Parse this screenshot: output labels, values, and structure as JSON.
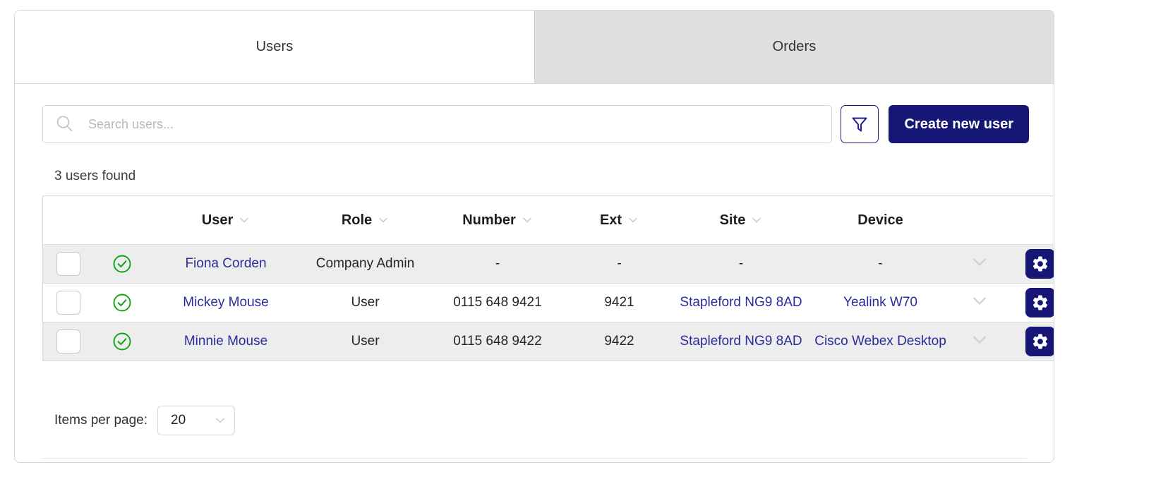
{
  "tabs": [
    {
      "label": "Users",
      "active": true,
      "name": "tab-users"
    },
    {
      "label": "Orders",
      "active": false,
      "name": "tab-orders"
    }
  ],
  "toolbar": {
    "search_placeholder": "Search users...",
    "search_value": "",
    "search_icon": "search-icon",
    "filter_icon": "filter-funnel-icon",
    "create_label": "Create new user"
  },
  "results": {
    "count_text": "3 users found"
  },
  "table": {
    "columns": [
      {
        "label": "",
        "sortable": false,
        "key": "select"
      },
      {
        "label": "",
        "sortable": false,
        "key": "status"
      },
      {
        "label": "User",
        "sortable": true,
        "key": "user"
      },
      {
        "label": "Role",
        "sortable": true,
        "key": "role"
      },
      {
        "label": "Number",
        "sortable": true,
        "key": "number"
      },
      {
        "label": "Ext",
        "sortable": true,
        "key": "ext"
      },
      {
        "label": "Site",
        "sortable": true,
        "key": "site"
      },
      {
        "label": "Device",
        "sortable": false,
        "key": "device"
      },
      {
        "label": "",
        "sortable": false,
        "key": "expand"
      },
      {
        "label": "",
        "sortable": false,
        "key": "actions"
      }
    ],
    "rows": [
      {
        "status_icon": "check-circle-icon",
        "user": "Fiona Corden",
        "role": "Company Admin",
        "number": "-",
        "ext": "-",
        "site": "-",
        "device": "-",
        "user_is_link": true,
        "site_is_link": false,
        "device_is_link": false
      },
      {
        "status_icon": "check-circle-icon",
        "user": "Mickey Mouse",
        "role": "User",
        "number": "0115 648 9421",
        "ext": "9421",
        "site": "Stapleford NG9 8AD",
        "device": "Yealink W70",
        "user_is_link": true,
        "site_is_link": true,
        "device_is_link": true
      },
      {
        "status_icon": "check-circle-icon",
        "user": "Minnie Mouse",
        "role": "User",
        "number": "0115 648 9422",
        "ext": "9422",
        "site": "Stapleford NG9 8AD",
        "device": "Cisco Webex Desktop",
        "user_is_link": true,
        "site_is_link": true,
        "device_is_link": true
      }
    ]
  },
  "pagination": {
    "items_per_page_label": "Items per page:",
    "items_per_page_value": "20"
  },
  "colors": {
    "brand_navy": "#161677",
    "link_blue": "#2b2b9e",
    "status_green": "#11a411",
    "tab_inactive_bg": "#e0e0e0",
    "row_stripe": "#ededed",
    "border": "#dcdcdc"
  }
}
